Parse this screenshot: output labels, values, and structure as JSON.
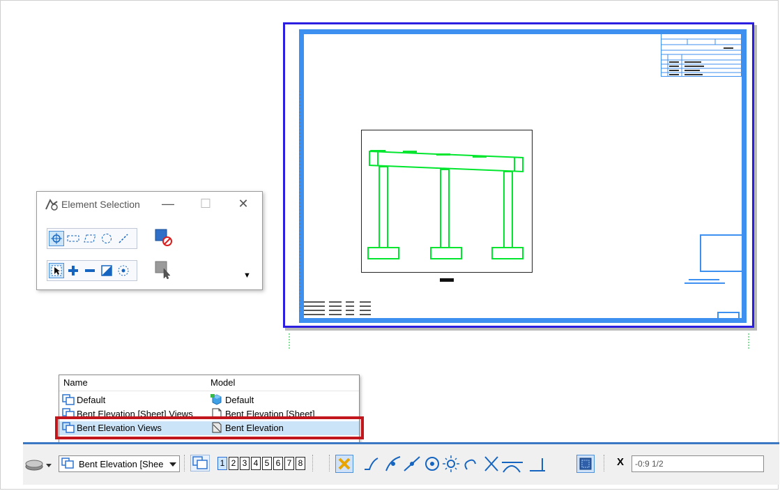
{
  "dialog": {
    "title": "Element Selection",
    "minimize_glyph": "—",
    "maximize_glyph": "☐",
    "close_glyph": "✕",
    "expand_glyph": "▼"
  },
  "model_list": {
    "columns": [
      "Name",
      "Model"
    ],
    "rows": [
      {
        "name": "Default",
        "model": "Default",
        "selected": false
      },
      {
        "name": "Bent Elevation [Sheet] Views",
        "model": "Bent Elevation [Sheet]",
        "selected": false
      },
      {
        "name": "Bent Elevation Views",
        "model": "Bent Elevation",
        "selected": true
      }
    ]
  },
  "toolbar": {
    "model_combo_value": "Bent Elevation [Shee",
    "view_numbers": [
      "1",
      "2",
      "3",
      "4",
      "5",
      "6",
      "7",
      "8"
    ],
    "active_view": "1",
    "x_label": "X",
    "x_value": "-0:9 1/2"
  },
  "colors": {
    "sheet_border": "#2c1ee0",
    "sheet_frame": "#3d8ff0",
    "geometry": "#00e62e",
    "highlight": "#c0161c",
    "toolbar_accent": "#3b78c4"
  }
}
